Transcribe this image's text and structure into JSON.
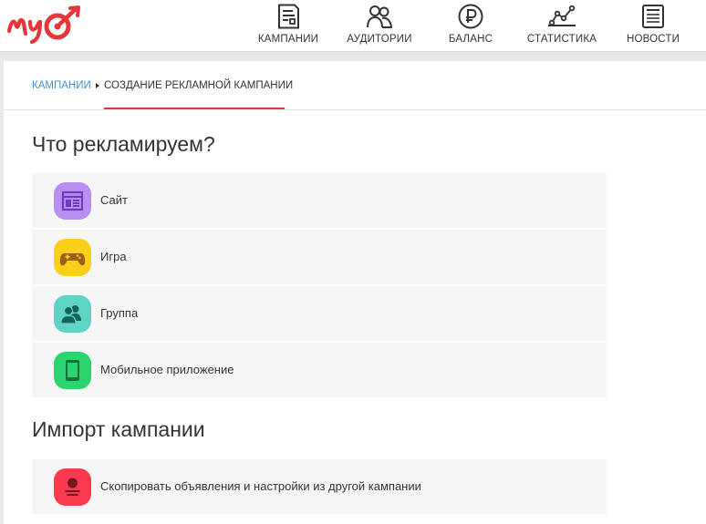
{
  "header": {
    "nav": [
      {
        "id": "campaigns",
        "label": "КАМПАНИИ",
        "icon": "campaigns-document-icon"
      },
      {
        "id": "audiences",
        "label": "АУДИТОРИИ",
        "icon": "audience-people-icon"
      },
      {
        "id": "balance",
        "label": "БАЛАНС",
        "icon": "ruble-coin-icon"
      },
      {
        "id": "stats",
        "label": "СТАТИСТИКА",
        "icon": "statistics-chart-icon"
      },
      {
        "id": "news",
        "label": "НОВОСТИ",
        "icon": "news-newspaper-icon"
      }
    ],
    "active_nav": "stats"
  },
  "breadcrumb": {
    "root": "КАМПАНИИ",
    "current": "СОЗДАНИЕ РЕКЛАМНОЙ КАМПАНИИ"
  },
  "what_section": {
    "title": "Что рекламируем?",
    "options": [
      {
        "label": "Сайт",
        "icon": "website-icon",
        "color": "#b98ff2"
      },
      {
        "label": "Игра",
        "icon": "gamepad-icon",
        "color": "#fcd01a"
      },
      {
        "label": "Группа",
        "icon": "group-people-icon",
        "color": "#5fd4c4"
      },
      {
        "label": "Мобильное приложение",
        "icon": "mobile-phone-icon",
        "color": "#2cd46f"
      }
    ]
  },
  "import_section": {
    "title": "Импорт кампании",
    "options": [
      {
        "label": "Скопировать объявления и настройки из другой кампании",
        "icon": "copy-campaign-icon",
        "color": "#fb3a4e"
      }
    ]
  },
  "colors": {
    "brand_red": "#e8353a",
    "link_blue": "#4a90c8",
    "option_bg": "#f6f6f6"
  }
}
